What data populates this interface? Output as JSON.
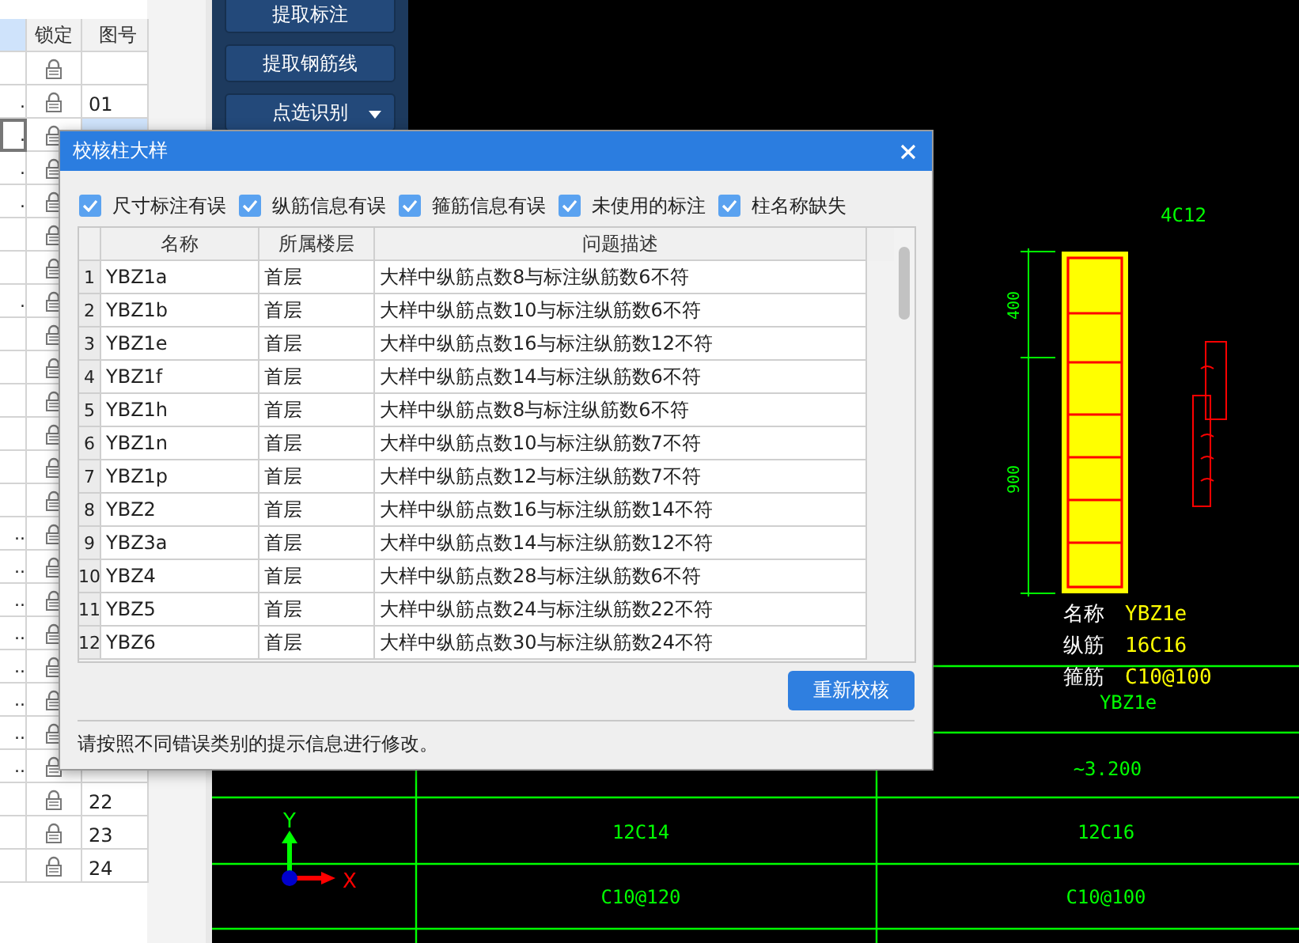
{
  "left_table": {
    "columns": [
      "锁定",
      "图号"
    ],
    "rows": [
      {
        "cut": "",
        "number": "",
        "selected": false
      },
      {
        "cut": ".",
        "number": "01",
        "selected": false
      },
      {
        "cut": ".",
        "selected": true
      },
      {
        "cut": ".",
        "selected": false
      },
      {
        "cut": ".",
        "selected": false
      },
      {
        "cut": "",
        "selected": false
      },
      {
        "cut": "",
        "selected": false
      },
      {
        "cut": ".",
        "selected": false
      },
      {
        "cut": "",
        "selected": false
      },
      {
        "cut": "",
        "selected": false
      },
      {
        "cut": "",
        "selected": false
      },
      {
        "cut": "",
        "selected": false
      },
      {
        "cut": "",
        "selected": false
      },
      {
        "cut": "",
        "selected": false
      },
      {
        "cut": "..",
        "selected": false
      },
      {
        "cut": "..",
        "selected": false
      },
      {
        "cut": "..",
        "selected": false
      },
      {
        "cut": "..",
        "selected": false
      },
      {
        "cut": "..",
        "selected": false
      },
      {
        "cut": "..",
        "selected": false
      },
      {
        "cut": "..",
        "selected": false
      },
      {
        "cut": "..",
        "selected": false
      },
      {
        "cut": "",
        "number": "22",
        "selected": false
      },
      {
        "cut": "",
        "number": "23",
        "selected": false
      },
      {
        "cut": "",
        "number": "24",
        "selected": false
      }
    ]
  },
  "tool_buttons": [
    {
      "label": "提取标注",
      "dropdown": false
    },
    {
      "label": "提取钢筋线",
      "dropdown": false
    },
    {
      "label": "点选识别",
      "dropdown": true
    }
  ],
  "cad": {
    "top_label": "4C12",
    "dims": [
      "400",
      "900"
    ],
    "legend": [
      {
        "label": "名称",
        "value": "YBZ1e"
      },
      {
        "label": "纵筋",
        "value": "16C16"
      },
      {
        "label": "箍筋",
        "value": "C10@100"
      }
    ],
    "grid_labels": [
      "YBZ1e",
      "~3.200",
      "12C14",
      "12C16",
      "C10@120",
      "C10@100"
    ],
    "axis": [
      "Y",
      "X"
    ]
  },
  "dialog": {
    "title": "校核柱大样",
    "filters": [
      {
        "label": "尺寸标注有误",
        "checked": true
      },
      {
        "label": "纵筋信息有误",
        "checked": true
      },
      {
        "label": "箍筋信息有误",
        "checked": true
      },
      {
        "label": "未使用的标注",
        "checked": true
      },
      {
        "label": "柱名称缺失",
        "checked": true
      }
    ],
    "columns": [
      "名称",
      "所属楼层",
      "问题描述"
    ],
    "rows": [
      {
        "no": "1",
        "name": "YBZ1a",
        "floor": "首层",
        "issue": "大样中纵筋点数8与标注纵筋数6不符"
      },
      {
        "no": "2",
        "name": "YBZ1b",
        "floor": "首层",
        "issue": "大样中纵筋点数10与标注纵筋数6不符"
      },
      {
        "no": "3",
        "name": "YBZ1e",
        "floor": "首层",
        "issue": "大样中纵筋点数16与标注纵筋数12不符"
      },
      {
        "no": "4",
        "name": "YBZ1f",
        "floor": "首层",
        "issue": "大样中纵筋点数14与标注纵筋数6不符"
      },
      {
        "no": "5",
        "name": "YBZ1h",
        "floor": "首层",
        "issue": "大样中纵筋点数8与标注纵筋数6不符"
      },
      {
        "no": "6",
        "name": "YBZ1n",
        "floor": "首层",
        "issue": "大样中纵筋点数10与标注纵筋数7不符"
      },
      {
        "no": "7",
        "name": "YBZ1p",
        "floor": "首层",
        "issue": "大样中纵筋点数12与标注纵筋数7不符"
      },
      {
        "no": "8",
        "name": "YBZ2",
        "floor": "首层",
        "issue": "大样中纵筋点数16与标注纵筋数14不符"
      },
      {
        "no": "9",
        "name": "YBZ3a",
        "floor": "首层",
        "issue": "大样中纵筋点数14与标注纵筋数12不符"
      },
      {
        "no": "10",
        "name": "YBZ4",
        "floor": "首层",
        "issue": "大样中纵筋点数28与标注纵筋数6不符"
      },
      {
        "no": "11",
        "name": "YBZ5",
        "floor": "首层",
        "issue": "大样中纵筋点数24与标注纵筋数22不符"
      },
      {
        "no": "12",
        "name": "YBZ6",
        "floor": "首层",
        "issue": "大样中纵筋点数30与标注纵筋数24不符"
      }
    ],
    "action_button": "重新校核",
    "hint": "请按照不同错误类别的提示信息进行修改。"
  }
}
